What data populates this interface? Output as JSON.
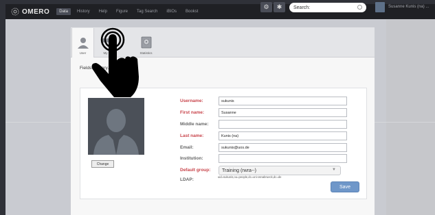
{
  "app": {
    "logo_text": "OMERO"
  },
  "nav": {
    "items": [
      {
        "label": "Data",
        "active": true
      },
      {
        "label": "History",
        "active": false
      },
      {
        "label": "Help",
        "active": false
      },
      {
        "label": "Figure",
        "active": false
      },
      {
        "label": "Tag Search",
        "active": false
      },
      {
        "label": "iBIOs",
        "active": false
      },
      {
        "label": "Bookst",
        "active": false
      }
    ]
  },
  "search": {
    "placeholder": "Search:"
  },
  "user": {
    "name": "Susanne Kunis (na) ..."
  },
  "tabs": [
    {
      "label": "User",
      "icon": "user-icon",
      "active": true
    },
    {
      "label": "My",
      "icon": "group-icon",
      "active": false
    },
    {
      "label": "Statistics",
      "icon": "disk-icon",
      "active": false
    }
  ],
  "notice": "Fields m                     atory.",
  "form": {
    "change_label": "Change",
    "fields": [
      {
        "label": "Username:",
        "value": "sukunis",
        "required": true
      },
      {
        "label": "First name:",
        "value": "Susanne",
        "required": true
      },
      {
        "label": "Middle name:",
        "value": "",
        "required": false
      },
      {
        "label": "Last name:",
        "value": "Kunis (na)",
        "required": true
      },
      {
        "label": "Email:",
        "value": "sukunis@uos.de",
        "required": false
      },
      {
        "label": "Institution:",
        "value": "",
        "required": false
      }
    ],
    "default_group_label": "Default group:",
    "default_group_value": "Training (rwra--)",
    "ldap_label": "LDAP:",
    "ldap_value": "uid=sukunis,ou=people,dc=uni-osnabrueck,dc=de",
    "save_label": "Save"
  },
  "colors": {
    "accent": "#6f97c9",
    "required": "#c8434a"
  }
}
